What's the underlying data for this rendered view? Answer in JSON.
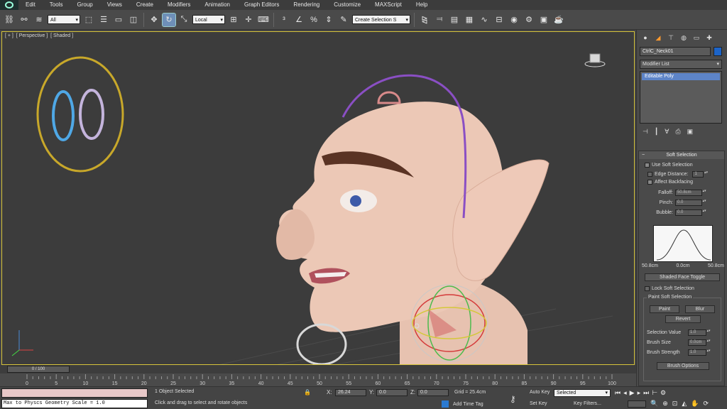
{
  "menu": {
    "items": [
      "Edit",
      "Tools",
      "Group",
      "Views",
      "Create",
      "Modifiers",
      "Animation",
      "Graph Editors",
      "Rendering",
      "Customize",
      "MAXScript",
      "Help"
    ]
  },
  "toolbar": {
    "selection_filter": "All",
    "ref_coord": "Local",
    "named_selection": "Create Selection S"
  },
  "viewport": {
    "label_plus": "[ + ]",
    "label_view": "[ Perspective ]",
    "label_shading": "[ Shaded ]"
  },
  "command_panel": {
    "object_name": "CtrlC_Neck01",
    "object_color": "#1c64c8",
    "modifier_list": "Modifier List",
    "stack_item": "Editable Poly",
    "soft_selection": {
      "title": "Soft Selection",
      "use_soft_selection": "Use Soft Selection",
      "edge_distance": "Edge Distance:",
      "edge_distance_value": "1",
      "affect_backfacing": "Affect Backfacing",
      "falloff_label": "Falloff:",
      "falloff_value": "50.8cm",
      "pinch_label": "Pinch:",
      "pinch_value": "0.0",
      "bubble_label": "Bubble:",
      "bubble_value": "0.0",
      "curve_left": "50.8cm",
      "curve_mid": "0.0cm",
      "curve_right": "50.8cm",
      "shaded_face_toggle": "Shaded Face Toggle",
      "lock_soft_selection": "Lock Soft Selection",
      "paint_group": "Paint Soft Selection",
      "paint": "Paint",
      "blur": "Blur",
      "revert": "Revert",
      "selection_value_label": "Selection Value",
      "selection_value": "1.0",
      "brush_size_label": "Brush Size",
      "brush_size": "0.0cm",
      "brush_strength_label": "Brush Strength",
      "brush_strength": "1.0",
      "brush_options": "Brush Options"
    }
  },
  "timeline": {
    "slider_label": "0 / 100",
    "ticks": [
      "0",
      "5",
      "10",
      "15",
      "20",
      "25",
      "30",
      "35",
      "40",
      "45",
      "50",
      "55",
      "60",
      "65",
      "70",
      "75",
      "80",
      "85",
      "90",
      "95",
      "100"
    ]
  },
  "status": {
    "maxscript_output": "Max to Physcs Geometry Scale = 1.0",
    "selection": "1 Object Selected",
    "prompt": "Click and drag to select and rotate objects",
    "x_label": "X:",
    "x_value": "26.24",
    "y_label": "Y:",
    "y_value": "0.0",
    "z_label": "Z:",
    "z_value": "0.0",
    "grid": "Grid = 25.4cm",
    "add_time_tag": "Add Time Tag",
    "auto_key": "Auto Key",
    "set_key": "Set Key",
    "key_mode": "Selected",
    "key_filters": "Key Filters..."
  }
}
